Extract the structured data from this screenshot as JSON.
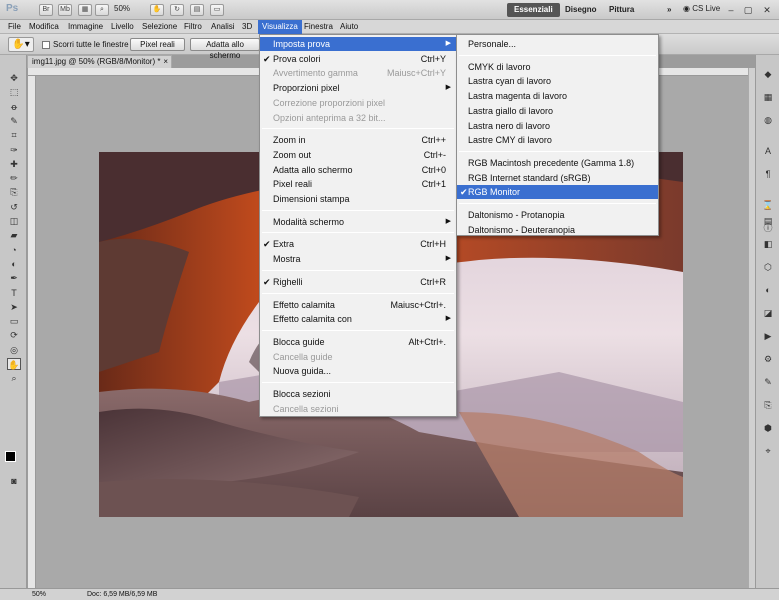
{
  "app": {
    "logo": "Ps",
    "mini_buttons": [
      "Br",
      "Mb"
    ],
    "zoom": "50%",
    "workspaces": [
      "Essenziali",
      "Disegno",
      "Pittura"
    ],
    "overflow": "»",
    "cs_live": "CS Live",
    "window_controls": [
      "–",
      "▢",
      "✕"
    ]
  },
  "menubar": [
    "File",
    "Modifica",
    "Immagine",
    "Livello",
    "Selezione",
    "Filtro",
    "Analisi",
    "3D",
    "Visualizza",
    "Finestra",
    "Aiuto"
  ],
  "options": {
    "scroll_all_label": "Scorri tutte le finestre",
    "btn_actual": "Pixel reali",
    "btn_fit": "Adatta allo schermo"
  },
  "document": {
    "tab_title": "img11.jpg @ 50% (RGB/8/Monitor) *",
    "close": "×"
  },
  "status": {
    "zoom": "50%",
    "doc": "Doc: 6,59 MB/6,59 MB"
  },
  "view_menu": [
    {
      "label": "Imposta prova",
      "arrow": true,
      "highlight": true
    },
    {
      "label": "Prova colori",
      "shortcut": "Ctrl+Y",
      "check": true
    },
    {
      "label": "Avvertimento gamma",
      "shortcut": "Maiusc+Ctrl+Y",
      "disabled": true
    },
    {
      "label": "Proporzioni pixel",
      "arrow": true
    },
    {
      "label": "Correzione proporzioni pixel",
      "disabled": true
    },
    {
      "label": "Opzioni anteprima a 32 bit...",
      "disabled": true
    },
    {
      "sep": true
    },
    {
      "label": "Zoom in",
      "shortcut": "Ctrl++"
    },
    {
      "label": "Zoom out",
      "shortcut": "Ctrl+-"
    },
    {
      "label": "Adatta allo schermo",
      "shortcut": "Ctrl+0"
    },
    {
      "label": "Pixel reali",
      "shortcut": "Ctrl+1"
    },
    {
      "label": "Dimensioni stampa"
    },
    {
      "sep": true
    },
    {
      "label": "Modalità schermo",
      "arrow": true
    },
    {
      "sep": true
    },
    {
      "label": "Extra",
      "shortcut": "Ctrl+H",
      "check": true
    },
    {
      "label": "Mostra",
      "arrow": true
    },
    {
      "sep": true
    },
    {
      "label": "Righelli",
      "shortcut": "Ctrl+R",
      "check": true
    },
    {
      "sep": true
    },
    {
      "label": "Effetto calamita",
      "shortcut": "Maiusc+Ctrl+."
    },
    {
      "label": "Effetto calamita con",
      "arrow": true
    },
    {
      "sep": true
    },
    {
      "label": "Blocca guide",
      "shortcut": "Alt+Ctrl+."
    },
    {
      "label": "Cancella guide",
      "disabled": true
    },
    {
      "label": "Nuova guida..."
    },
    {
      "sep": true
    },
    {
      "label": "Blocca sezioni"
    },
    {
      "label": "Cancella sezioni",
      "disabled": true
    }
  ],
  "proof_menu": [
    {
      "label": "Personale..."
    },
    {
      "sep": true
    },
    {
      "label": "CMYK di lavoro"
    },
    {
      "label": "Lastra cyan di lavoro"
    },
    {
      "label": "Lastra magenta di lavoro"
    },
    {
      "label": "Lastra giallo di lavoro"
    },
    {
      "label": "Lastra nero di lavoro"
    },
    {
      "label": "Lastre CMY di lavoro"
    },
    {
      "sep": true
    },
    {
      "label": "RGB Macintosh precedente (Gamma 1.8)"
    },
    {
      "label": "RGB Internet standard (sRGB)"
    },
    {
      "label": "RGB Monitor",
      "check": true,
      "highlight": true
    },
    {
      "sep": true
    },
    {
      "label": "Daltonismo - Protanopia"
    },
    {
      "label": "Daltonismo - Deuteranopia"
    }
  ],
  "tools": [
    "move-tool",
    "marquee-tool",
    "lasso-tool",
    "quick-select-tool",
    "crop-tool",
    "eyedropper-tool",
    "healing-tool",
    "brush-tool",
    "clone-stamp-tool",
    "history-brush-tool",
    "eraser-tool",
    "gradient-tool",
    "blur-tool",
    "dodge-tool",
    "pen-tool",
    "type-tool",
    "path-select-tool",
    "shape-tool",
    "3d-rotate-tool",
    "3d-orbit-tool",
    "hand-tool",
    "zoom-tool"
  ],
  "right_panel_icons": [
    "color-panel-icon",
    "swatches-panel-icon",
    "styles-panel-icon",
    "character-panel-icon",
    "paragraph-panel-icon",
    "history-panel-icon",
    "info-panel-icon",
    "layers-panel-icon",
    "channels-panel-icon",
    "paths-panel-icon",
    "adjustments-panel-icon",
    "masks-panel-icon",
    "actions-panel-icon",
    "tool-presets-panel-icon",
    "brush-panel-icon",
    "clone-source-panel-icon",
    "3d-panel-icon",
    "navigator-panel-icon"
  ],
  "colors": {
    "accent": "#3a6fd0",
    "menu_bg": "#f1f1f1",
    "workspace_bg": "#a9a9a9"
  }
}
